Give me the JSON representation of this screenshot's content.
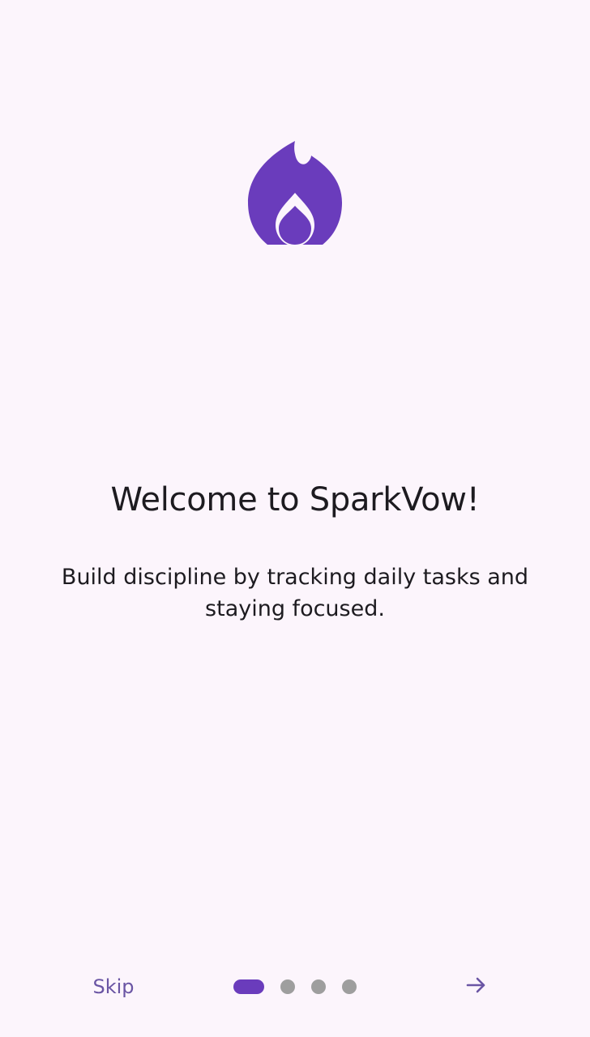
{
  "app": {
    "name": "SparkVow"
  },
  "onboarding": {
    "logo_icon": "flame-icon",
    "title": "Welcome to SparkVow!",
    "subtitle": "Build discipline by tracking daily tasks and staying focused.",
    "skip_label": "Skip",
    "next_icon": "arrow-right-icon",
    "page_indicator": {
      "total": 4,
      "current": 1
    }
  },
  "colors": {
    "background": "#fcf5fc",
    "accent": "#6a3cbc",
    "text": "#1d1b20",
    "link": "#6a55a4",
    "dot_inactive": "#9e9e9e"
  }
}
